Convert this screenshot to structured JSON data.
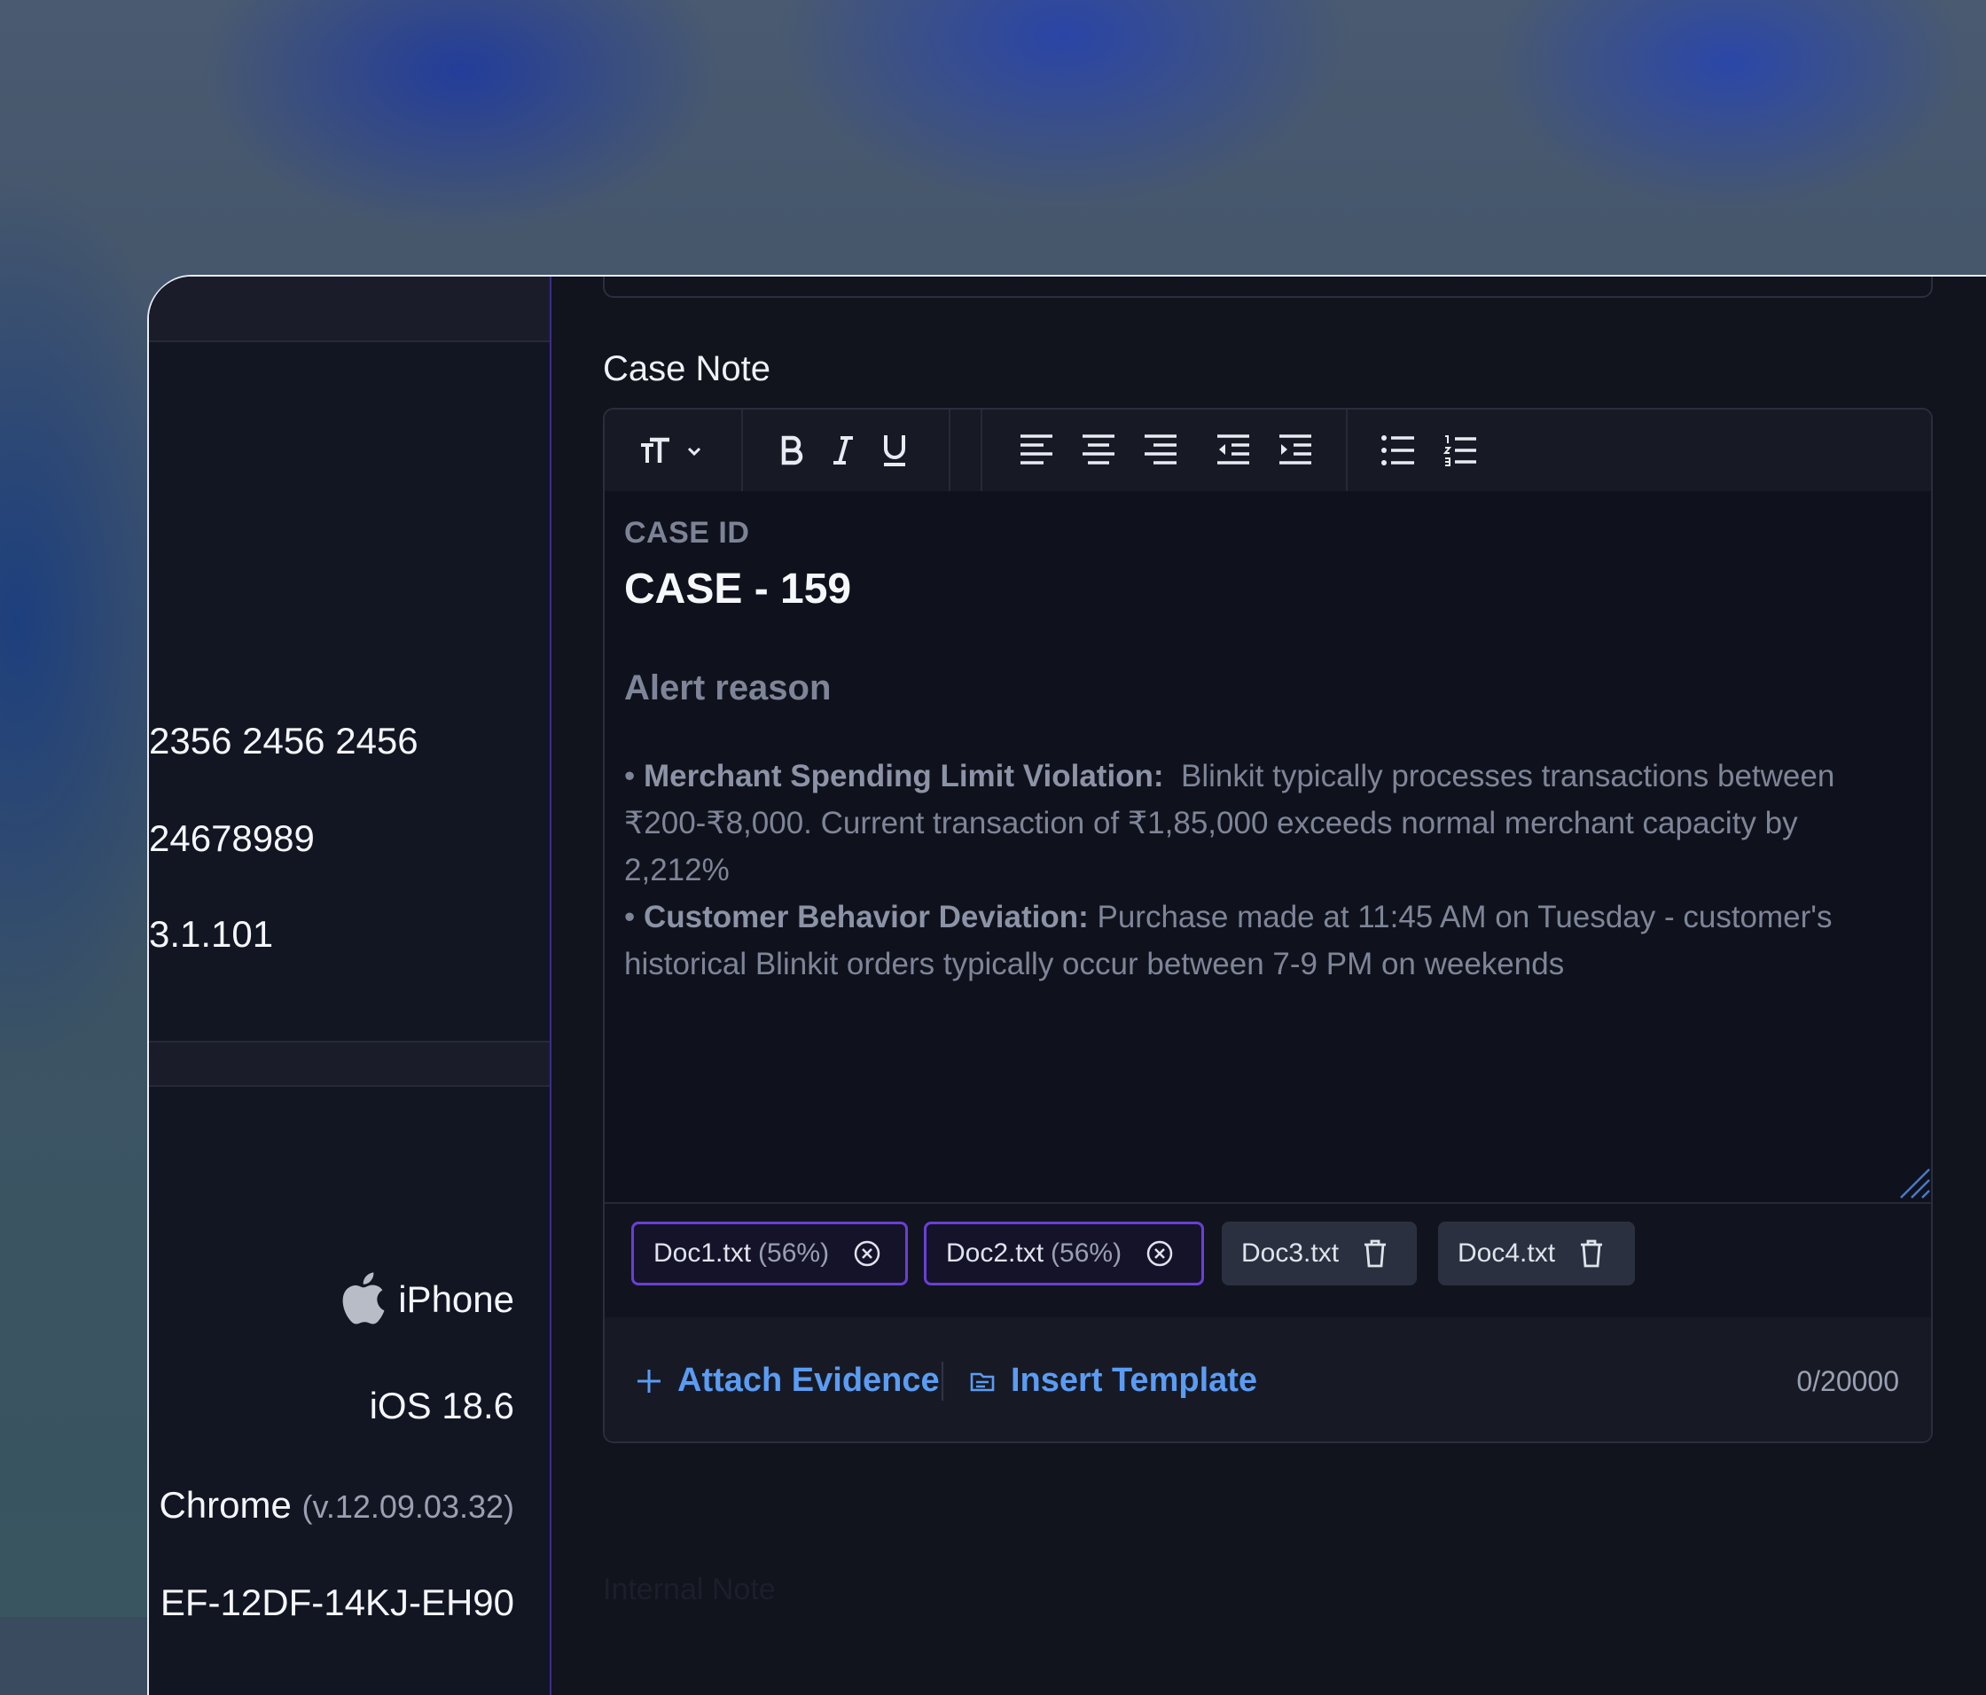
{
  "sidebar": {
    "values": [
      "2356  2456  2456",
      "24678989",
      "3.1.101"
    ],
    "device": "iPhone",
    "os": "iOS 18.6",
    "browser": "Chrome",
    "browser_version": "(v.12.09.03.32)",
    "device_id": "EF-12DF-14KJ-EH90"
  },
  "case_note": {
    "label": "Case Note",
    "case_id_label": "CASE ID",
    "case_id": "CASE - 159",
    "alert_heading": "Alert reason",
    "bullet1_title": "Merchant Spending Limit Violation:",
    "bullet1_text": "Blinkit typically processes transactions between ₹200-₹8,000. Current transaction of ₹1,85,000 exceeds normal merchant capacity by 2,212%",
    "bullet2_title": "Customer Behavior Deviation:",
    "bullet2_text": "Purchase made at 11:45 AM on Tuesday - customer's historical Blinkit orders typically occur between 7-9 PM on weekends"
  },
  "attachments": [
    {
      "name": "Doc1.txt",
      "progress": "(56%)",
      "state": "uploading"
    },
    {
      "name": "Doc2.txt",
      "progress": "(56%)",
      "state": "uploading"
    },
    {
      "name": "Doc3.txt",
      "state": "done"
    },
    {
      "name": "Doc4.txt",
      "state": "done"
    }
  ],
  "footer": {
    "attach_label": "Attach Evidence",
    "template_label": "Insert Template",
    "counter": "0/20000"
  },
  "ghost_label": "Internal Note",
  "colors": {
    "accent": "#5b9cf3",
    "upload_border": "#6a3fd6",
    "sidebar_border": "#3b2d8c",
    "panel_bg": "#11131d"
  }
}
